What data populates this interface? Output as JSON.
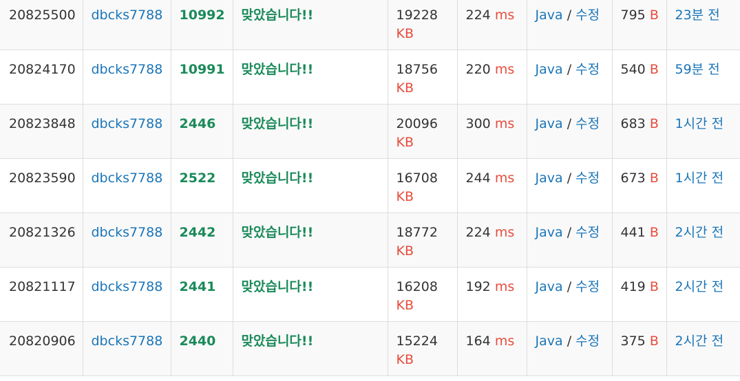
{
  "rows": [
    {
      "id": "20825500",
      "user": "dbcks7788",
      "problem": "10992",
      "result": "맞았습니다!!",
      "memory": "19228",
      "memory_unit": "KB",
      "time": "224",
      "time_unit": "ms",
      "lang": "Java",
      "sep": "/",
      "edit": "수정",
      "code_len": "795",
      "code_unit": "B",
      "submitted": "23분 전"
    },
    {
      "id": "20824170",
      "user": "dbcks7788",
      "problem": "10991",
      "result": "맞았습니다!!",
      "memory": "18756",
      "memory_unit": "KB",
      "time": "220",
      "time_unit": "ms",
      "lang": "Java",
      "sep": "/",
      "edit": "수정",
      "code_len": "540",
      "code_unit": "B",
      "submitted": "59분 전"
    },
    {
      "id": "20823848",
      "user": "dbcks7788",
      "problem": "2446",
      "result": "맞았습니다!!",
      "memory": "20096",
      "memory_unit": "KB",
      "time": "300",
      "time_unit": "ms",
      "lang": "Java",
      "sep": "/",
      "edit": "수정",
      "code_len": "683",
      "code_unit": "B",
      "submitted": "1시간 전"
    },
    {
      "id": "20823590",
      "user": "dbcks7788",
      "problem": "2522",
      "result": "맞았습니다!!",
      "memory": "16708",
      "memory_unit": "KB",
      "time": "244",
      "time_unit": "ms",
      "lang": "Java",
      "sep": "/",
      "edit": "수정",
      "code_len": "673",
      "code_unit": "B",
      "submitted": "1시간 전"
    },
    {
      "id": "20821326",
      "user": "dbcks7788",
      "problem": "2442",
      "result": "맞았습니다!!",
      "memory": "18772",
      "memory_unit": "KB",
      "time": "224",
      "time_unit": "ms",
      "lang": "Java",
      "sep": "/",
      "edit": "수정",
      "code_len": "441",
      "code_unit": "B",
      "submitted": "2시간 전"
    },
    {
      "id": "20821117",
      "user": "dbcks7788",
      "problem": "2441",
      "result": "맞았습니다!!",
      "memory": "16208",
      "memory_unit": "KB",
      "time": "192",
      "time_unit": "ms",
      "lang": "Java",
      "sep": "/",
      "edit": "수정",
      "code_len": "419",
      "code_unit": "B",
      "submitted": "2시간 전"
    },
    {
      "id": "20820906",
      "user": "dbcks7788",
      "problem": "2440",
      "result": "맞았습니다!!",
      "memory": "15224",
      "memory_unit": "KB",
      "time": "164",
      "time_unit": "ms",
      "lang": "Java",
      "sep": "/",
      "edit": "수정",
      "code_len": "375",
      "code_unit": "B",
      "submitted": "2시간 전"
    }
  ],
  "colors": {
    "link": "#1a75b8",
    "accepted": "#1b8a5a",
    "unit": "#e74c3c",
    "stripe": "#f9f9f9",
    "border": "#dddddd"
  }
}
